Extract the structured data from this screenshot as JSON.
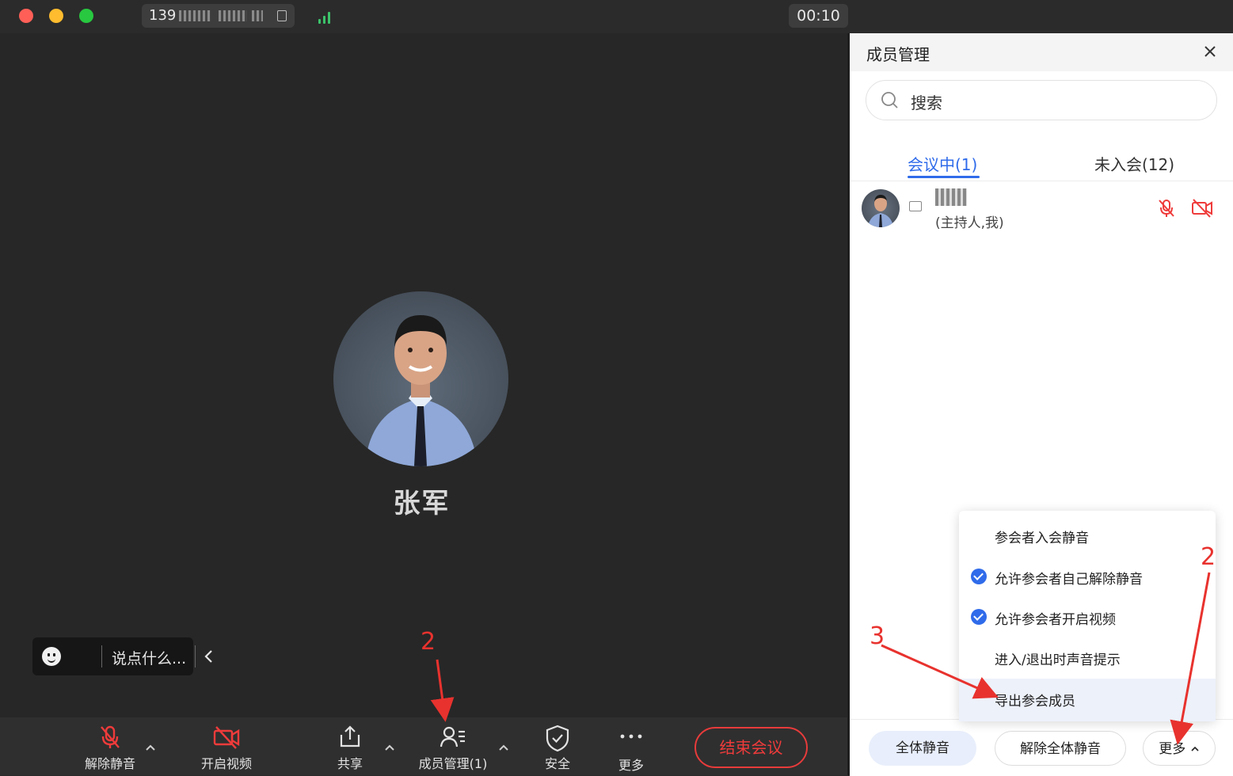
{
  "titlebar": {
    "meeting_id_prefix": "139",
    "timer": "00:10",
    "traffic_colors": [
      "#ff5f57",
      "#febc2e",
      "#28c840"
    ]
  },
  "main": {
    "participant_name": "张军",
    "chat_placeholder": "说点什么..."
  },
  "toolbar": {
    "unmute_label": "解除静音",
    "start_video_label": "开启视频",
    "share_label": "共享",
    "members_label": "成员管理(1)",
    "security_label": "安全",
    "more_label": "更多",
    "end_label": "结束会议"
  },
  "panel": {
    "title": "成员管理",
    "search_placeholder": "搜索",
    "tab_in_meeting": "会议中(1)",
    "tab_not_joined": "未入会(12)",
    "member_role": "(主持人,我)",
    "dropdown": [
      {
        "label": "参会者入会静音",
        "checked": false
      },
      {
        "label": "允许参会者自己解除静音",
        "checked": true
      },
      {
        "label": "允许参会者开启视频",
        "checked": true
      },
      {
        "label": "进入/退出时声音提示",
        "checked": false
      },
      {
        "label": "导出参会成员",
        "checked": false
      }
    ],
    "footer": {
      "mute_all": "全体静音",
      "unmute_all": "解除全体静音",
      "more": "更多"
    }
  },
  "annotations": {
    "toolbar_step": "2",
    "more_step": "2",
    "export_step": "3",
    "color": "#e8322e"
  },
  "colors": {
    "accent_blue": "#2f6bea",
    "danger_red": "#e83b3b",
    "signal_green": "#3cc26a"
  }
}
